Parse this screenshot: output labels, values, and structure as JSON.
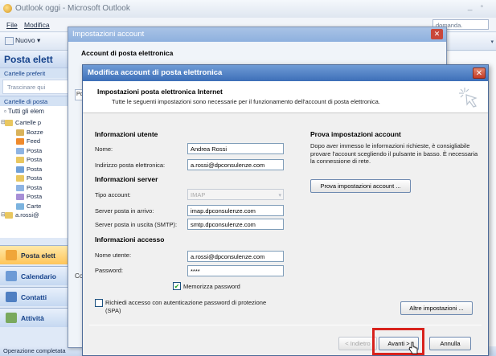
{
  "outlook": {
    "title": "Outlook oggi - Microsoft Outlook",
    "menu": [
      "File",
      "Modifica"
    ],
    "help_box": "domanda.",
    "toolbar": {
      "new_label": "Nuovo"
    },
    "nav": {
      "header": "Posta elett",
      "favorites": "Cartelle preferit",
      "drag_hint": "Trascinare qui",
      "mail_folders": "Cartelle di posta",
      "all_items": "Tutti gli elem",
      "tree": [
        {
          "label": "Cartelle p",
          "color": "#e9c760",
          "indent": 0
        },
        {
          "label": "Bozze",
          "color": "#d9b25a",
          "indent": 1
        },
        {
          "label": "Feed",
          "color": "#ef8a2c",
          "indent": 1
        },
        {
          "label": "Posta",
          "color": "#8eb4e3",
          "indent": 1
        },
        {
          "label": "Posta",
          "color": "#e9c760",
          "indent": 1
        },
        {
          "label": "Posta",
          "color": "#6fa0d8",
          "indent": 1
        },
        {
          "label": "Posta",
          "color": "#e9c760",
          "indent": 1
        },
        {
          "label": "Posta",
          "color": "#8eb4e3",
          "indent": 1
        },
        {
          "label": "Posta",
          "color": "#a78fd6",
          "indent": 1
        },
        {
          "label": "Carte",
          "color": "#7bb3df",
          "indent": 1
        },
        {
          "label": "a.rossi@",
          "color": "#e9c760",
          "indent": 0
        }
      ],
      "buttons": [
        {
          "label": "Posta elett",
          "color": "#f0a63a",
          "active": true
        },
        {
          "label": "Calendario",
          "color": "#6e9bd6",
          "active": false
        },
        {
          "label": "Contatti",
          "color": "#4f7fc2",
          "active": false
        },
        {
          "label": "Attività",
          "color": "#7aa95e",
          "active": false
        }
      ]
    },
    "status": "Operazione completata"
  },
  "account_settings": {
    "title": "Impostazioni account",
    "heading": "Account di posta elettronica",
    "stub_left": "Po",
    "stub_bottom": "Co"
  },
  "edit_account": {
    "title": "Modifica account di posta elettronica",
    "banner_heading": "Impostazioni posta elettronica Internet",
    "banner_sub": "Tutte le seguenti impostazioni sono necessarie per il funzionamento dell'account di posta elettronica.",
    "user_info": {
      "heading": "Informazioni utente",
      "name_label": "Nome:",
      "name_value": "Andrea Rossi",
      "email_label": "Indirizzo posta elettronica:",
      "email_value": "a.rossi@dpconsulenze.com"
    },
    "server_info": {
      "heading": "Informazioni server",
      "type_label": "Tipo account:",
      "type_value": "IMAP",
      "incoming_label": "Server posta in arrivo:",
      "incoming_value": "imap.dpconsulenze.com",
      "outgoing_label": "Server posta in uscita (SMTP):",
      "outgoing_value": "smtp.dpconsulenze.com"
    },
    "access_info": {
      "heading": "Informazioni accesso",
      "user_label": "Nome utente:",
      "user_value": "a.rossi@dpconsulenze.com",
      "password_label": "Password:",
      "password_value": "****",
      "remember_label": "Memorizza password",
      "remember_checked": true
    },
    "spa_label": "Richiedi accesso con autenticazione password di protezione (SPA)",
    "spa_checked": false,
    "test": {
      "heading": "Prova impostazioni account",
      "description": "Dopo aver immesso le informazioni richieste, è consigliabile provare l'account scegliendo il pulsante in basso. È necessaria la connessione di rete.",
      "button": "Prova impostazioni account ..."
    },
    "more_settings": "Altre impostazioni ...",
    "back": "< Indietro",
    "next": "Avanti >",
    "cancel": "Annulla",
    "highlight_color": "#d8221c"
  }
}
